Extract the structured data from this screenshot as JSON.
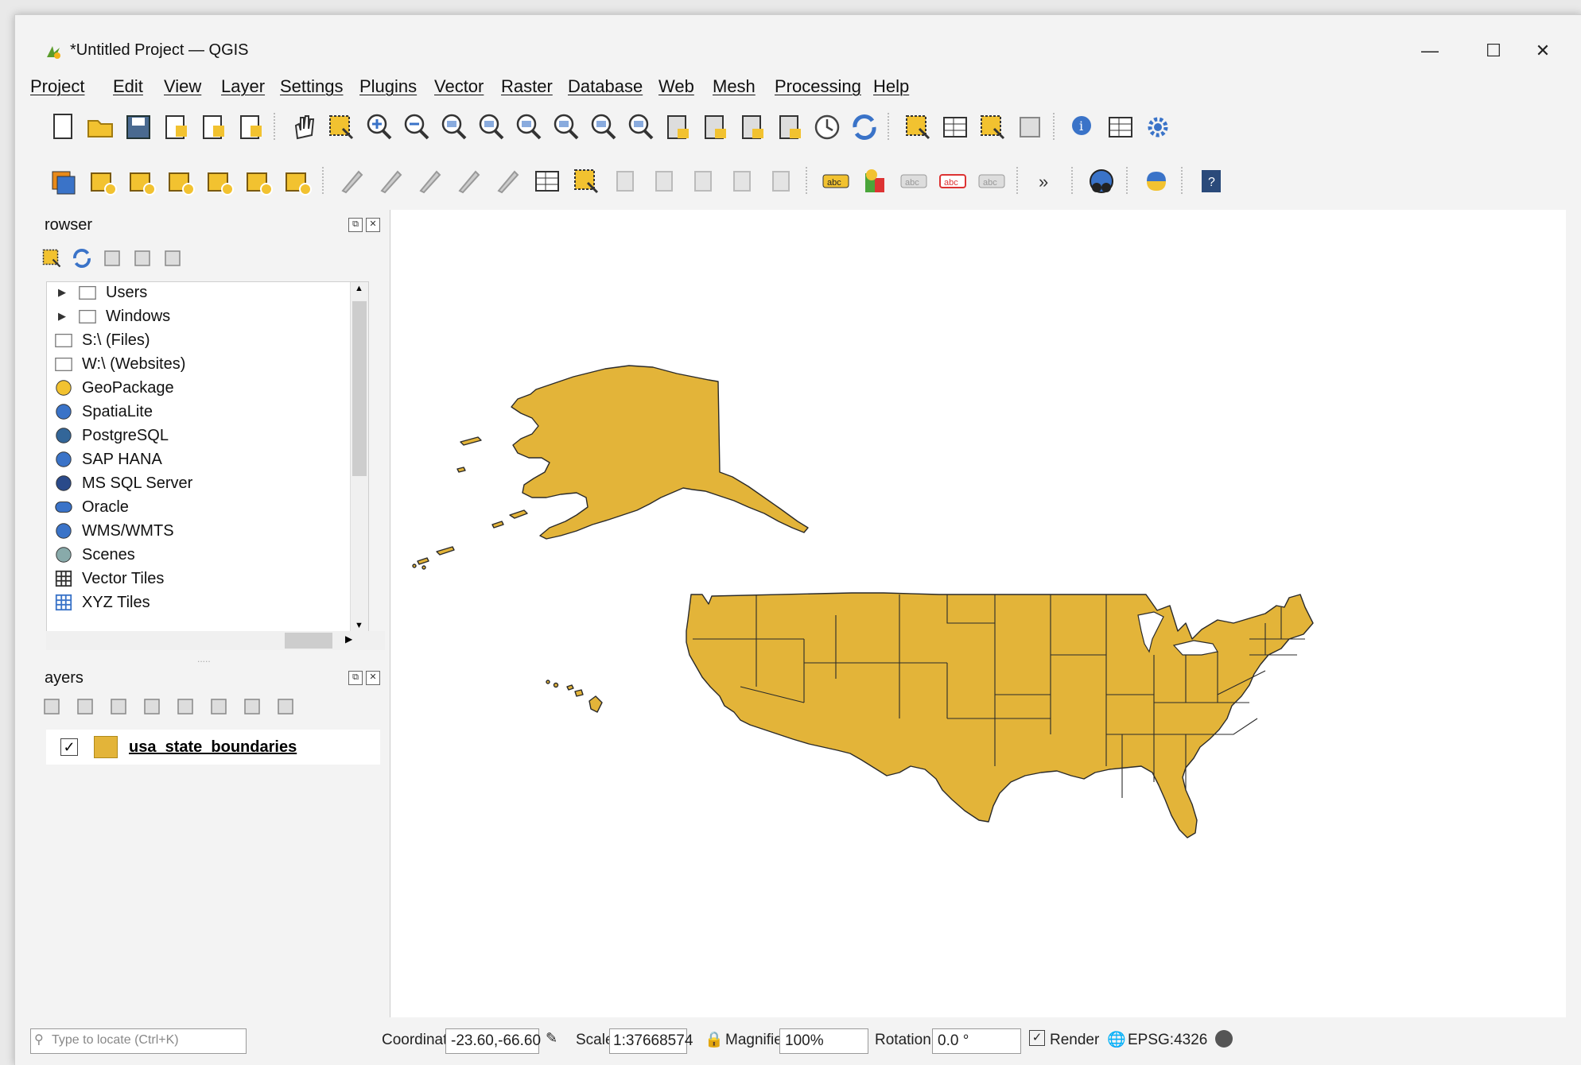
{
  "window": {
    "title": "*Untitled Project — QGIS",
    "controls": [
      "—",
      "☐",
      "✕"
    ]
  },
  "menu": [
    "Project",
    "Edit",
    "View",
    "Layer",
    "Settings",
    "Plugins",
    "Vector",
    "Raster",
    "Database",
    "Web",
    "Mesh",
    "Processing",
    "Help"
  ],
  "toolbar1": [
    "new-project-icon",
    "open-project-icon",
    "save-project-icon",
    "new-print-layout-icon",
    "layout-manager-icon",
    "style-manager-icon",
    "pan-icon",
    "pan-to-selection-icon",
    "zoom-in-icon",
    "zoom-out-icon",
    "zoom-full-icon",
    "zoom-to-selection-icon",
    "zoom-to-layer-icon",
    "zoom-native-icon",
    "zoom-last-icon",
    "zoom-next-icon",
    "new-map-view-icon",
    "new-3d-map-view-icon",
    "new-spatial-bookmark-icon",
    "show-bookmarks-icon",
    "temporal-controller-icon",
    "refresh-icon",
    "select-features-icon",
    "open-attribute-table-icon",
    "deselect-icon",
    "add-annotation-icon",
    "identify-icon",
    "statistics-icon",
    "settings-gear-icon"
  ],
  "toolbar2": [
    "open-datasource-manager-icon",
    "new-geopackage-layer-icon",
    "new-shapefile-layer-icon",
    "new-spatialite-layer-icon",
    "new-virtual-layer-icon",
    "new-temporary-layer-icon",
    "new-mesh-layer-icon",
    "current-edits-icon",
    "toggle-editing-icon",
    "save-edits-icon",
    "digitize-icon",
    "vertex-tool-icon",
    "modify-attributes-icon",
    "delete-selected-icon",
    "cut-features-icon",
    "copy-features-icon",
    "paste-features-icon",
    "undo-icon",
    "redo-icon",
    "label-toolbar-icon",
    "diagram-icon",
    "highlight-pinned-labels-icon",
    "pin-labels-icon",
    "show-hide-labels-icon",
    "more-icon",
    "geocoding-icon",
    "python-icon",
    "help-icon"
  ],
  "browser": {
    "title": "rowser",
    "tools": [
      "add-selected-icon",
      "refresh-icon",
      "filter-icon",
      "collapse-all-icon",
      "info-icon"
    ],
    "items": [
      {
        "label": "Users",
        "icon": "folder-icon",
        "expandable": true
      },
      {
        "label": "Windows",
        "icon": "folder-icon",
        "expandable": true
      },
      {
        "label": "S:\\ (Files)",
        "icon": "folder-icon",
        "expandable": false
      },
      {
        "label": "W:\\ (Websites)",
        "icon": "folder-icon",
        "expandable": false
      },
      {
        "label": "GeoPackage",
        "icon": "geopackage-icon",
        "expandable": false
      },
      {
        "label": "SpatiaLite",
        "icon": "spatialite-icon",
        "expandable": false
      },
      {
        "label": "PostgreSQL",
        "icon": "postgresql-icon",
        "expandable": false
      },
      {
        "label": "SAP HANA",
        "icon": "sap-hana-icon",
        "expandable": false
      },
      {
        "label": "MS SQL Server",
        "icon": "mssql-icon",
        "expandable": false
      },
      {
        "label": "Oracle",
        "icon": "oracle-icon",
        "expandable": false
      },
      {
        "label": "WMS/WMTS",
        "icon": "wms-icon",
        "expandable": false
      },
      {
        "label": "Scenes",
        "icon": "scenes-icon",
        "expandable": false
      },
      {
        "label": "Vector Tiles",
        "icon": "vector-tiles-icon",
        "expandable": false
      },
      {
        "label": "XYZ Tiles",
        "icon": "xyz-tiles-icon",
        "expandable": false
      }
    ]
  },
  "layers": {
    "title": "ayers",
    "tools": [
      "open-layer-styling-icon",
      "add-group-icon",
      "manage-visibility-icon",
      "filter-legend-icon",
      "filter-by-expression-icon",
      "expand-all-icon",
      "collapse-all-icon",
      "remove-layer-icon"
    ],
    "items": [
      {
        "name": "usa_state_boundaries",
        "checked": true,
        "fill": "#e3b439",
        "check_glyph": "✓"
      }
    ]
  },
  "map": {
    "fill": "#e3b439",
    "stroke": "#2a2a2a",
    "background": "#ffffff"
  },
  "status": {
    "locator_placeholder": "Type to locate (Ctrl+K)",
    "coordinate_label": "Coordinate",
    "coordinate_value": "-23.60,-66.60",
    "scale_label": "Scale",
    "scale_value": "1:37668574",
    "magnifier_label": "Magnifier",
    "magnifier_value": "100%",
    "rotation_label": "Rotation",
    "rotation_value": "0.0 °",
    "render_label": "Render",
    "crs_label": "EPSG:4326"
  }
}
